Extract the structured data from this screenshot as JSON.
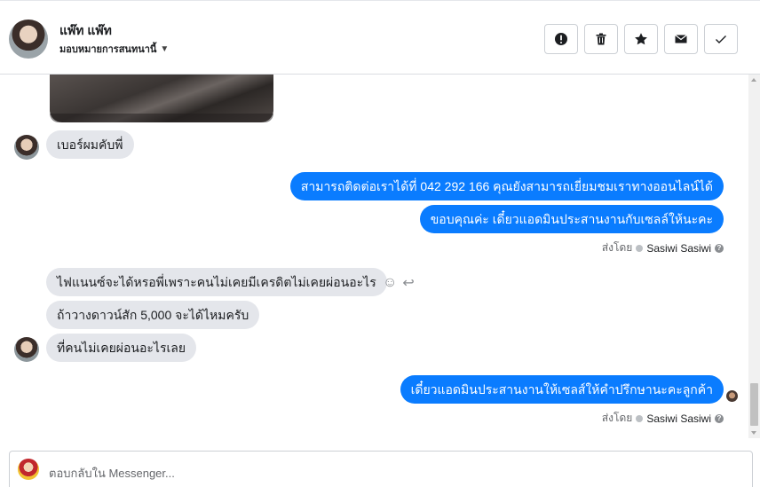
{
  "header": {
    "contact_name": "แพ๊ท แพ๊ท",
    "assign_label": "มอบหมายการสนทนานี้",
    "actions": [
      {
        "name": "report-button",
        "icon": "exclamation-icon"
      },
      {
        "name": "delete-button",
        "icon": "trash-icon"
      },
      {
        "name": "star-button",
        "icon": "star-icon"
      },
      {
        "name": "mark-unread-button",
        "icon": "envelope-icon"
      },
      {
        "name": "done-button",
        "icon": "check-icon"
      }
    ]
  },
  "messages": {
    "in1": "เบอร์ผมคับพี่",
    "out1": "สามารถติดต่อเราได้ที่ 042 292 166 คุณยังสามารถเยี่ยมชมเราทางออนไลน์ได้",
    "out2": "ขอบคุณค่ะ เดี๋ยวแอดมินประสานงานกับเซลล์ให้นะคะ",
    "in2": "ไฟแนนซ์จะได้หรอพี่เพราะคนไม่เคยมีเครดิตไม่เคยผ่อนอะไร",
    "in3": "ถ้าวางดาวน์สัก 5,000 จะได้ไหมครับ",
    "in4": "ที่คนไม่เคยผ่อนอะไรเลย",
    "out3": "เดี๋ยวแอดมินประสานงานให้เซลส์ให้คำปรึกษานะคะลูกค้า"
  },
  "sent_by": {
    "prefix": "ส่งโดย",
    "name": "Sasiwi Sasiwi",
    "help": "?"
  },
  "composer": {
    "placeholder": "ตอบกลับใน Messenger..."
  },
  "colors": {
    "outgoing_bubble": "#0a7cff",
    "incoming_bubble": "#e4e6eb"
  }
}
